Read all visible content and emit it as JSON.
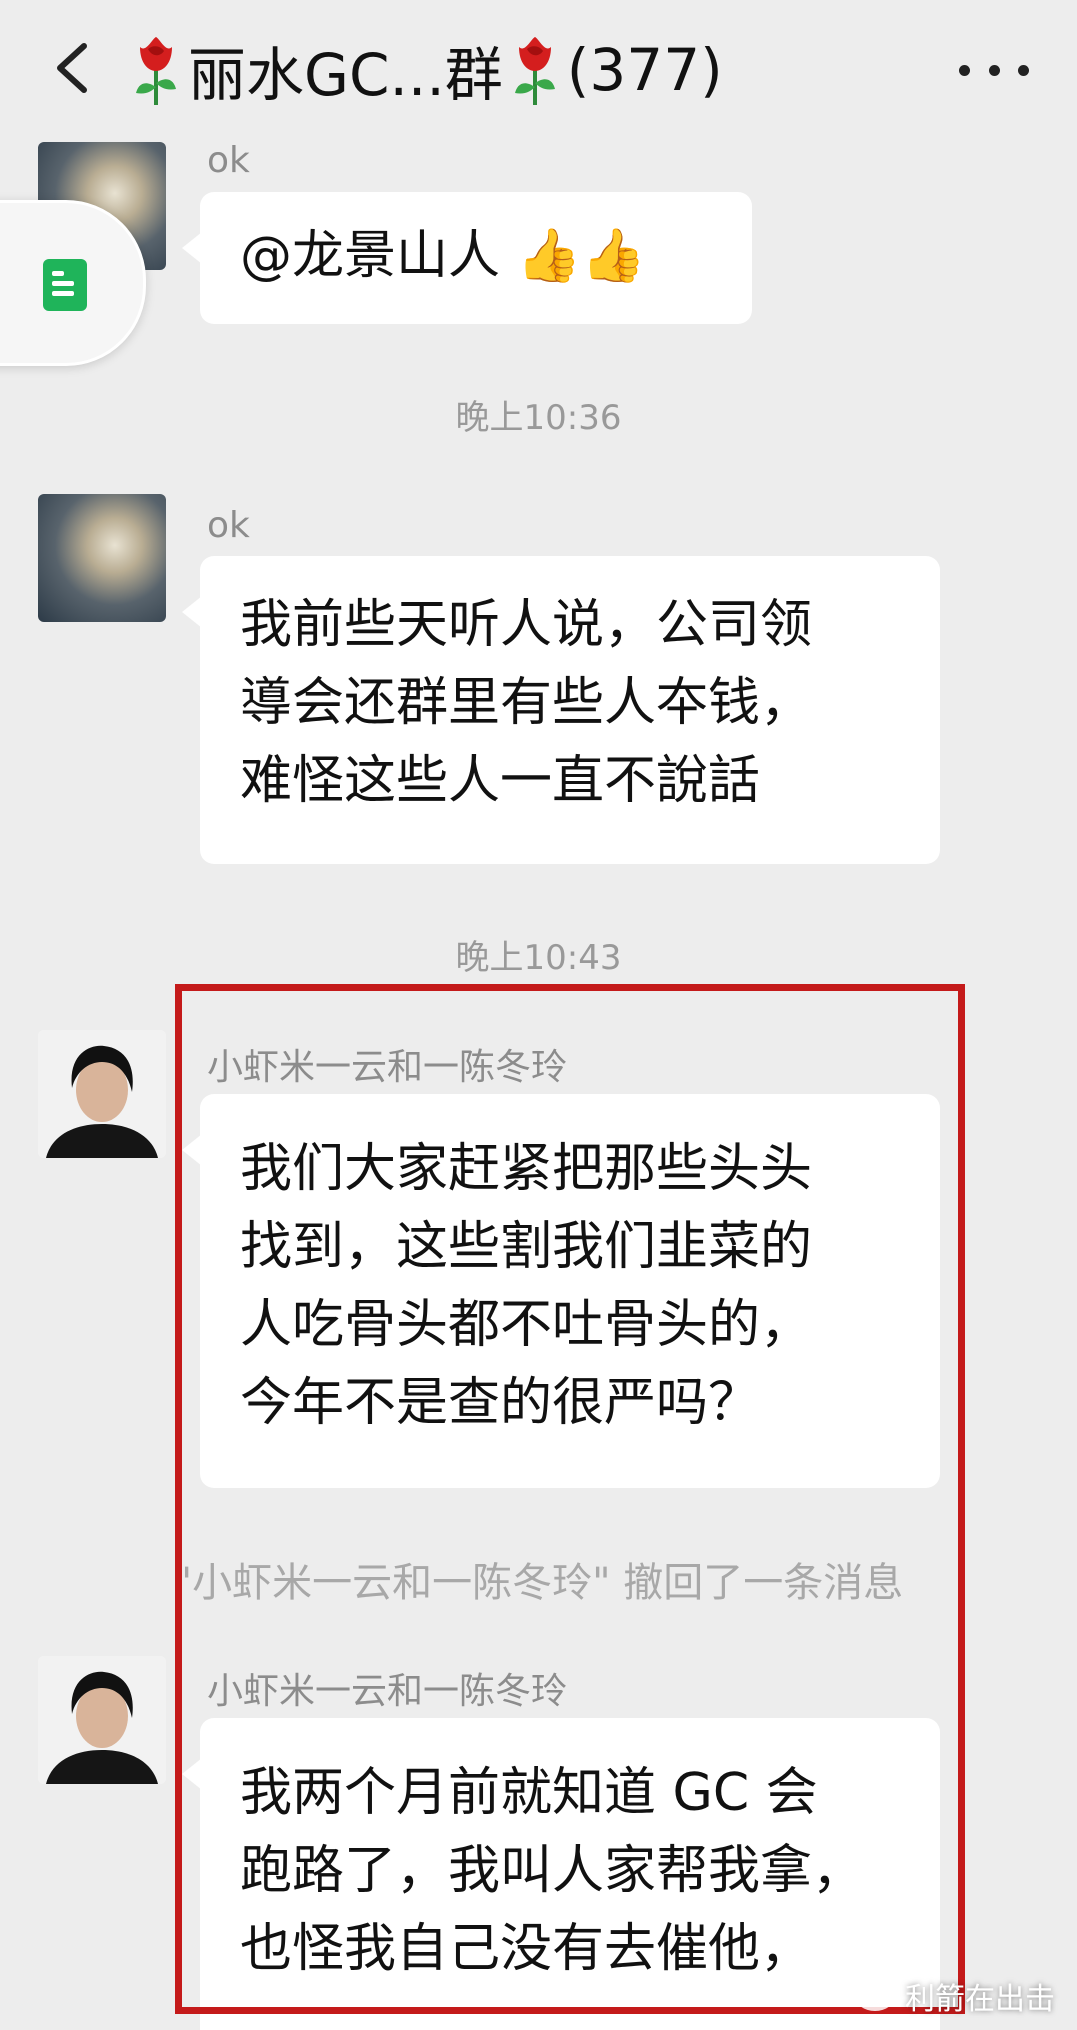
{
  "header": {
    "title_prefix": "丽水GC...群",
    "member_count": "(377)"
  },
  "messages": [
    {
      "type": "text",
      "sender": "ok",
      "avatar": "sky-avatar",
      "lines": [
        "@龙景山人 👍👍"
      ]
    },
    {
      "type": "time",
      "text": "晚上10:36"
    },
    {
      "type": "text",
      "sender": "ok",
      "avatar": "sky-avatar",
      "lines": [
        "我前些天听人说，公司领",
        "導会还群里有些人夲钱，",
        "难怪这些人一直不說話"
      ]
    },
    {
      "type": "time",
      "text": "晚上10:43"
    },
    {
      "type": "text",
      "sender": "小虾米一云和一陈冬玲",
      "avatar": "person-avatar",
      "lines": [
        "我们大家赶紧把那些头头",
        "找到，这些割我们韭菜的",
        "人吃骨头都不吐骨头的，",
        "今年不是查的很严吗？"
      ]
    },
    {
      "type": "recall",
      "text": "\"小虾米一云和一陈冬玲\" 撤回了一条消息"
    },
    {
      "type": "text",
      "sender": "小虾米一云和一陈冬玲",
      "avatar": "person-avatar",
      "lines": [
        "我两个月前就知道 GC 会",
        "跑路了，我叫人家帮我拿，",
        "也怪我自己没有去催他，"
      ]
    }
  ],
  "watermark": "利箭在出击",
  "icons": {
    "back": "chevron-left-icon",
    "more": "more-dots-icon",
    "rose": "rose-emoji-icon",
    "side": "document-icon"
  },
  "colors": {
    "background": "#ededed",
    "bubble": "#ffffff",
    "highlight": "#c41a1a",
    "doc_green": "#1fb45a"
  }
}
